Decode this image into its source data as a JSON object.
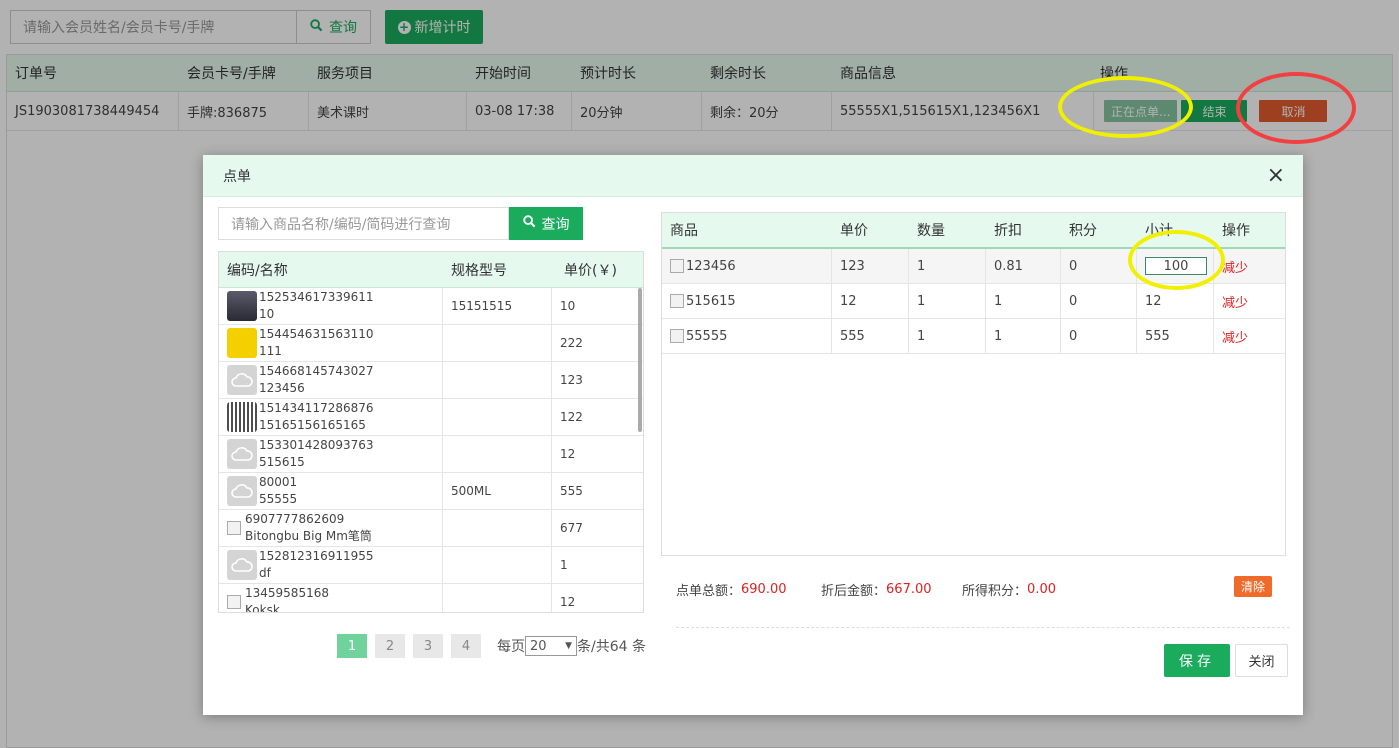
{
  "topbar": {
    "search_placeholder": "请输入会员姓名/会员卡号/手牌",
    "search_button": "查询",
    "add_button": "新增计时"
  },
  "orders": {
    "headers": [
      "订单号",
      "会员卡号/手牌",
      "服务项目",
      "开始时间",
      "预计时长",
      "剩余时长",
      "商品信息",
      "操作"
    ],
    "rows": [
      {
        "order_no": "JS1903081738449454",
        "card": "手牌:836875",
        "service": "美术课时",
        "start": "03-08 17:38",
        "duration": "20分钟",
        "remaining": "剩余：20分",
        "goods": "55555X1,515615X1,123456X1",
        "btn_ordering": "正在点单...",
        "btn_finish": "结束",
        "btn_cancel": "取消"
      }
    ]
  },
  "modal": {
    "title": "点单",
    "close_icon": "×",
    "product_search_placeholder": "请输入商品名称/编码/简码进行查询",
    "product_search_button": "查询",
    "product_headers": [
      "编码/名称",
      "规格型号",
      "单价(￥)"
    ],
    "products": [
      {
        "code": "152534617339611",
        "name": "10",
        "spec": "15151515",
        "price": "10",
        "thumb": "dark"
      },
      {
        "code": "154454631563110",
        "name": "111",
        "spec": "",
        "price": "222",
        "thumb": "yellow"
      },
      {
        "code": "154668145743027",
        "name": "123456",
        "spec": "",
        "price": "123",
        "thumb": "gray"
      },
      {
        "code": "151434117286876",
        "name": "15165156165165",
        "spec": "",
        "price": "122",
        "thumb": "qr"
      },
      {
        "code": "153301428093763",
        "name": "515615",
        "spec": "",
        "price": "12",
        "thumb": "gray"
      },
      {
        "code": "80001",
        "name": "55555",
        "spec": "500ML",
        "price": "555",
        "thumb": "gray"
      },
      {
        "code": "6907777862609",
        "name": "Bitongbu Big Mm笔筒",
        "spec": "",
        "price": "677",
        "thumb": "broken"
      },
      {
        "code": "152812316911955",
        "name": "df",
        "spec": "",
        "price": "1",
        "thumb": "gray"
      },
      {
        "code": "13459585168",
        "name": "Koksk",
        "spec": "",
        "price": "12",
        "thumb": "broken"
      }
    ],
    "pager": {
      "pages": [
        "1",
        "2",
        "3",
        "4"
      ],
      "active_page": "1",
      "per_page_label": "每页",
      "per_page_value": "20",
      "total_label": "条/共64 条"
    },
    "order_headers": [
      "商品",
      "单价",
      "数量",
      "折扣",
      "积分",
      "小计",
      "操作"
    ],
    "order_items": [
      {
        "name": "123456",
        "price": "123",
        "qty": "1",
        "discount": "0.81",
        "points": "0",
        "subtotal": "100",
        "action": "减少"
      },
      {
        "name": "515615",
        "price": "12",
        "qty": "1",
        "discount": "1",
        "points": "0",
        "subtotal": "12",
        "action": "减少"
      },
      {
        "name": "55555",
        "price": "555",
        "qty": "1",
        "discount": "1",
        "points": "0",
        "subtotal": "555",
        "action": "减少"
      }
    ],
    "summary": {
      "total_label": "点单总额：",
      "total_value": "690.00",
      "discounted_label": "折后金额：",
      "discounted_value": "667.00",
      "points_label": "所得积分：",
      "points_value": "0.00",
      "clear_button": "清除"
    },
    "save_button": "保存",
    "close_button": "关闭"
  },
  "colors": {
    "brand_green": "#1aab5c",
    "header_bg": "#e6f9ee",
    "cancel_red": "#e25c2e",
    "highlight_yellow": "#f0f000",
    "highlight_red": "#f24040"
  }
}
